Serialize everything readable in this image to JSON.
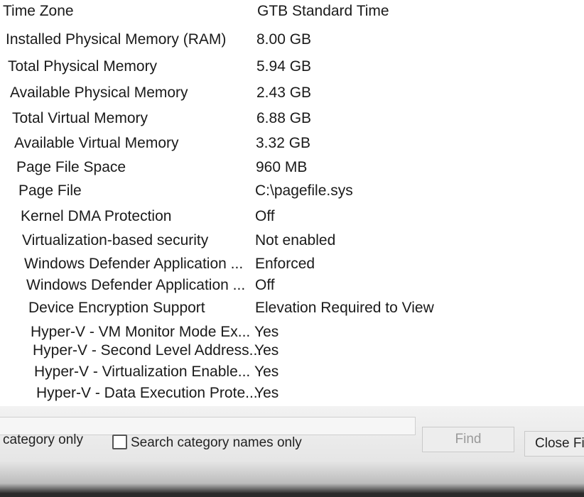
{
  "table": {
    "rows": [
      {
        "item": "Time Zone",
        "value": "GTB Standard Time"
      },
      {
        "item": "Installed Physical Memory (RAM)",
        "value": "8.00 GB"
      },
      {
        "item": "Total Physical Memory",
        "value": "5.94 GB"
      },
      {
        "item": "Available Physical Memory",
        "value": "2.43 GB"
      },
      {
        "item": "Total Virtual Memory",
        "value": "6.88 GB"
      },
      {
        "item": "Available Virtual Memory",
        "value": "3.32 GB"
      },
      {
        "item": "Page File Space",
        "value": "960 MB"
      },
      {
        "item": "Page File",
        "value": "C:\\pagefile.sys"
      },
      {
        "item": "Kernel DMA Protection",
        "value": "Off"
      },
      {
        "item": "Virtualization-based security",
        "value": "Not enabled"
      },
      {
        "item": "Windows Defender Application ...",
        "value": "Enforced"
      },
      {
        "item": "Windows Defender Application ...",
        "value": "Off"
      },
      {
        "item": "Device Encryption Support",
        "value": "Elevation Required to View"
      },
      {
        "item": "Hyper-V - VM Monitor Mode Ex...",
        "value": "Yes"
      },
      {
        "item": "Hyper-V - Second Level Address...",
        "value": "Yes"
      },
      {
        "item": "Hyper-V - Virtualization Enable...",
        "value": "Yes"
      },
      {
        "item": "Hyper-V - Data Execution Prote...",
        "value": "Yes"
      }
    ]
  },
  "find_bar": {
    "category_only_label": "category only",
    "search_category_names_label": "Search category names only",
    "find_button": "Find",
    "close_find_button": "Close Fi"
  }
}
